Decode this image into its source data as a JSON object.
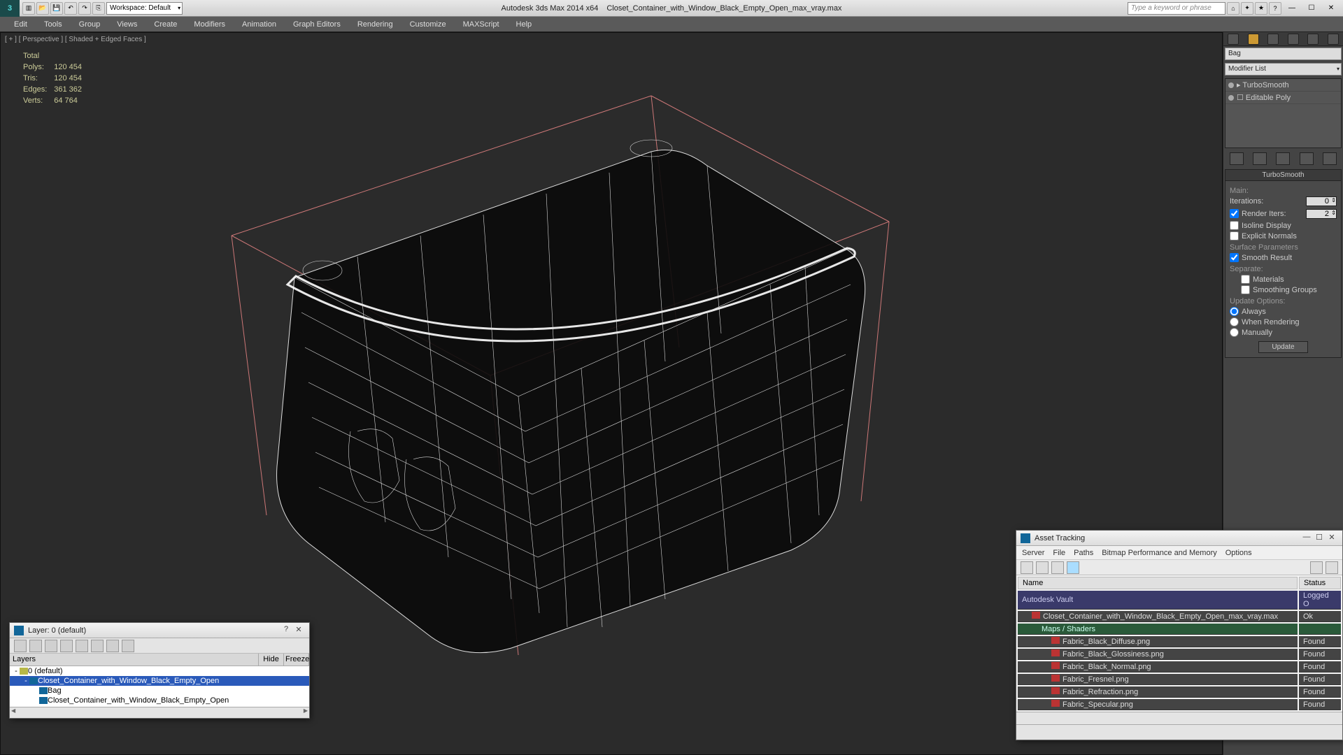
{
  "title": {
    "app": "Autodesk 3ds Max 2014 x64",
    "file": "Closet_Container_with_Window_Black_Empty_Open_max_vray.max"
  },
  "workspace": {
    "label": "Workspace: Default"
  },
  "search": {
    "placeholder": "Type a keyword or phrase"
  },
  "menu": [
    "Edit",
    "Tools",
    "Group",
    "Views",
    "Create",
    "Modifiers",
    "Animation",
    "Graph Editors",
    "Rendering",
    "Customize",
    "MAXScript",
    "Help"
  ],
  "viewport": {
    "label": "[ + ] [ Perspective ] [ Shaded + Edged Faces ]"
  },
  "stats": {
    "header": "Total",
    "rows": [
      {
        "k": "Polys:",
        "v": "120 454"
      },
      {
        "k": "Tris:",
        "v": "120 454"
      },
      {
        "k": "Edges:",
        "v": "361 362"
      },
      {
        "k": "Verts:",
        "v": "64 764"
      }
    ]
  },
  "cmd_panel": {
    "object": "Bag",
    "modlist": "Modifier List",
    "stack": [
      {
        "name": "TurboSmooth",
        "expandable": true
      },
      {
        "name": "Editable Poly",
        "expandable": false
      }
    ],
    "rollout_title": "TurboSmooth",
    "main_label": "Main:",
    "iterations_label": "Iterations:",
    "iterations_val": "0",
    "render_iters_label": "Render Iters:",
    "render_iters_val": "2",
    "isoline": "Isoline Display",
    "explicit": "Explicit Normals",
    "surf_label": "Surface Parameters",
    "smooth_result": "Smooth Result",
    "separate": "Separate:",
    "materials": "Materials",
    "smgroups": "Smoothing Groups",
    "update_label": "Update Options:",
    "always": "Always",
    "when_render": "When Rendering",
    "manually": "Manually",
    "update_btn": "Update"
  },
  "layer_dlg": {
    "title": "Layer: 0 (default)",
    "cols": {
      "name": "Layers",
      "hide": "Hide",
      "freeze": "Freeze"
    },
    "rows": [
      {
        "depth": 0,
        "exp": "-",
        "name": "0 (default)",
        "sel": false,
        "ico": "#b8b848"
      },
      {
        "depth": 1,
        "exp": "-",
        "name": "Closet_Container_with_Window_Black_Empty_Open",
        "sel": true,
        "ico": "#169"
      },
      {
        "depth": 2,
        "exp": "",
        "name": "Bag",
        "sel": false,
        "ico": "#169"
      },
      {
        "depth": 2,
        "exp": "",
        "name": "Closet_Container_with_Window_Black_Empty_Open",
        "sel": false,
        "ico": "#169"
      }
    ]
  },
  "asset_dlg": {
    "title": "Asset Tracking",
    "menu": [
      "Server",
      "File",
      "Paths",
      "Bitmap Performance and Memory",
      "Options"
    ],
    "cols": {
      "name": "Name",
      "status": "Status"
    },
    "rows": [
      {
        "type": "hdr",
        "name": "Autodesk Vault",
        "status": "Logged O",
        "indent": 0
      },
      {
        "type": "file",
        "name": "Closet_Container_with_Window_Black_Empty_Open_max_vray.max",
        "status": "Ok",
        "indent": 1
      },
      {
        "type": "sec",
        "name": "Maps / Shaders",
        "status": "",
        "indent": 2
      },
      {
        "type": "map",
        "name": "Fabric_Black_Diffuse.png",
        "status": "Found",
        "indent": 3
      },
      {
        "type": "map",
        "name": "Fabric_Black_Glossiness.png",
        "status": "Found",
        "indent": 3
      },
      {
        "type": "map",
        "name": "Fabric_Black_Normal.png",
        "status": "Found",
        "indent": 3
      },
      {
        "type": "map",
        "name": "Fabric_Fresnel.png",
        "status": "Found",
        "indent": 3
      },
      {
        "type": "map",
        "name": "Fabric_Refraction.png",
        "status": "Found",
        "indent": 3
      },
      {
        "type": "map",
        "name": "Fabric_Specular.png",
        "status": "Found",
        "indent": 3
      }
    ]
  }
}
